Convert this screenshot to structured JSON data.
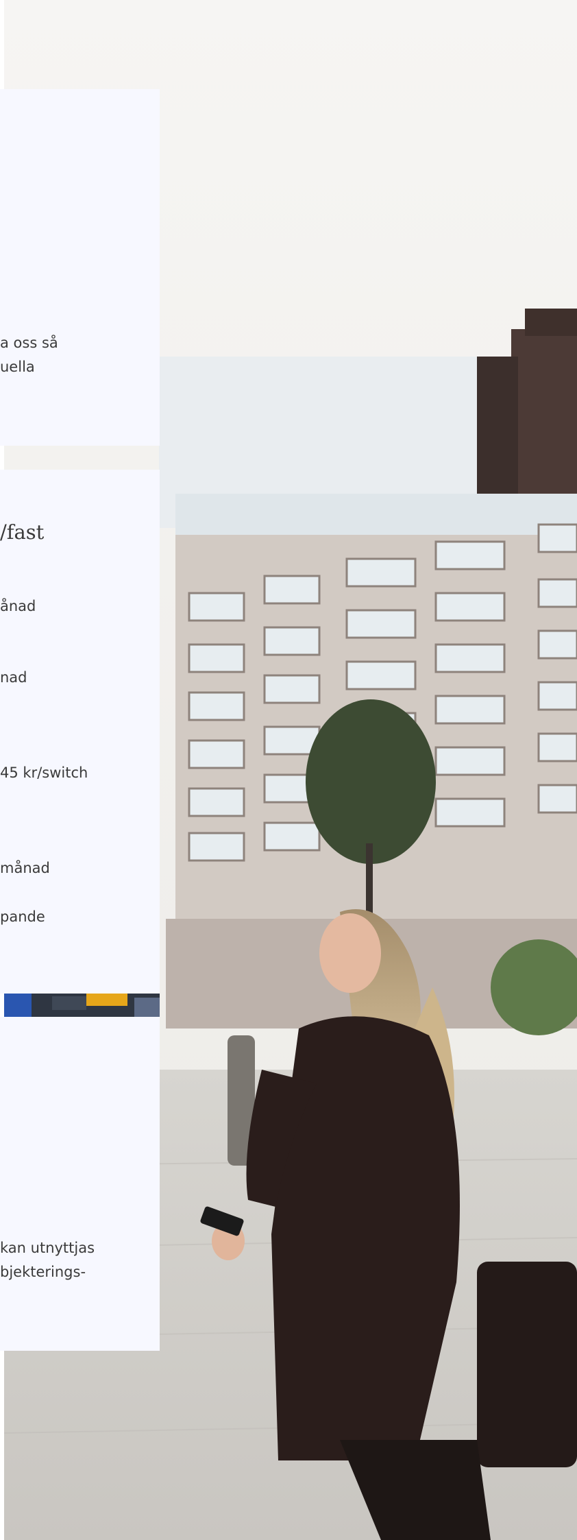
{
  "cards": [
    {
      "lines": [
        "a oss så",
        "uella"
      ]
    },
    {
      "heading": "/fast",
      "lines": [
        "ånad",
        "nad",
        "45 kr/switch",
        "månad",
        "pande"
      ]
    },
    {
      "lines": [
        "kan utnyttjas",
        "bjekterings-"
      ]
    }
  ],
  "colors": {
    "card_bg": "#f7f8ff",
    "text": "#3a3a3a",
    "sky": "#f5f3f0"
  },
  "photo_subject": "woman-with-phone-city-street"
}
